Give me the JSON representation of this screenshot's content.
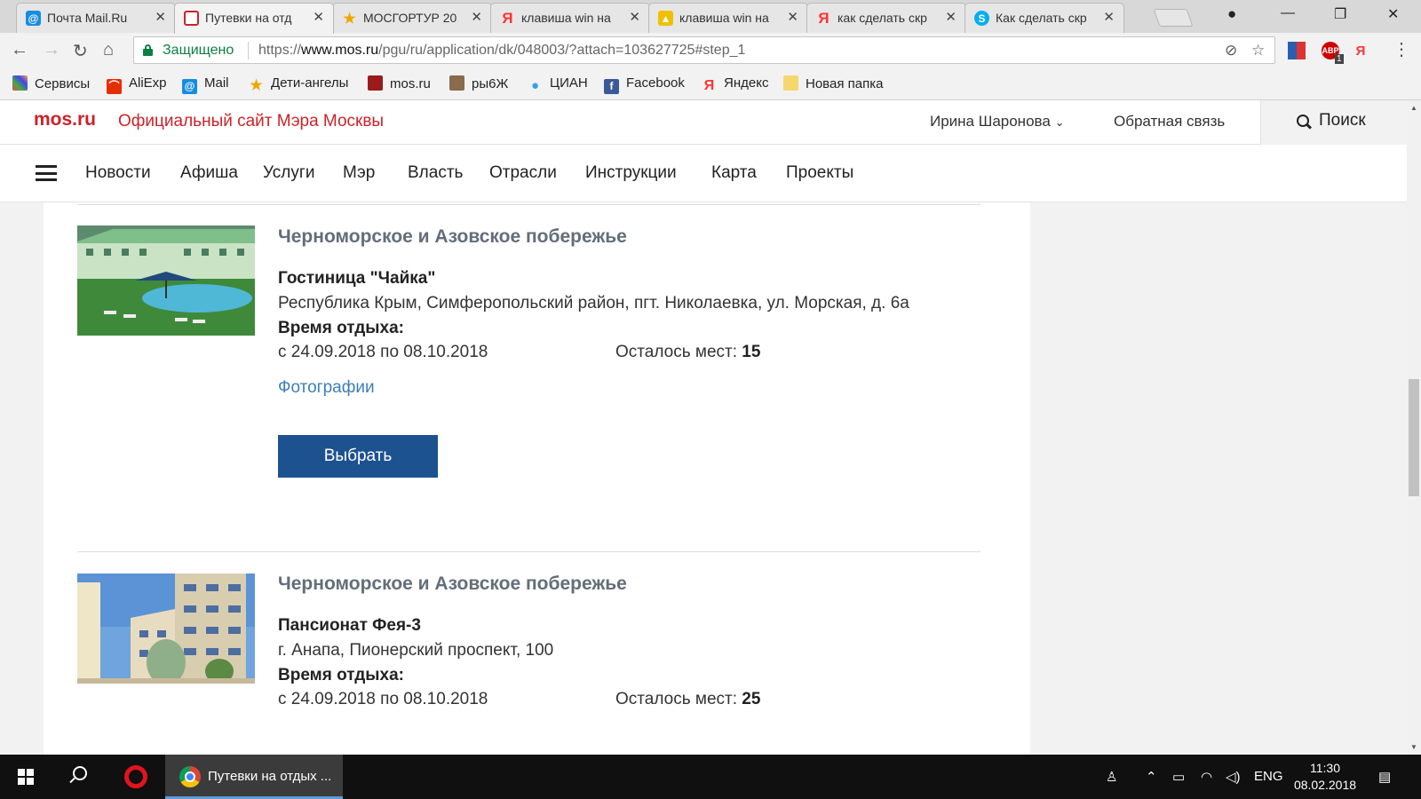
{
  "browser": {
    "tabs": [
      {
        "title": "Почта Mail.Ru",
        "icon": "mail-at-icon",
        "color": "#168de2"
      },
      {
        "title": "Путевки на отд",
        "icon": "mosru-page-icon",
        "color": "#cc2229"
      },
      {
        "title": "МОСГОРТУР 20",
        "icon": "star-icon",
        "color": "#f0a500"
      },
      {
        "title": "клавиша win на",
        "icon": "yandex-icon",
        "color": "#ff3333"
      },
      {
        "title": "клавиша win на",
        "icon": "yandex-images-icon",
        "color": "#f0c000"
      },
      {
        "title": "как сделать скр",
        "icon": "yandex-icon",
        "color": "#ff3333"
      },
      {
        "title": "Как сделать скр",
        "icon": "skype-icon",
        "color": "#00aff0"
      }
    ],
    "active_tab": 1,
    "secure_label": "Защищено",
    "url_scheme": "https://",
    "url_host": "www.mos.ru",
    "url_path": "/pgu/ru/application/dk/048003/?attach=103627725#step_1",
    "extensions": {
      "abp_label": "ABP",
      "abp_count": "1",
      "yandex_label": "Я"
    },
    "bookmarks": [
      {
        "label": "Сервисы",
        "icon": "apps-grid-icon",
        "color": "#e44"
      },
      {
        "label": "AliExp",
        "icon": "aliexpress-icon",
        "color": "#e62e04"
      },
      {
        "label": "Mail",
        "icon": "mail-at-icon",
        "color": "#168de2"
      },
      {
        "label": "Дети-ангелы",
        "icon": "star-icon",
        "color": "#f0a500"
      },
      {
        "label": "mos.ru",
        "icon": "mos-emblem-icon",
        "color": "#9b1b1b"
      },
      {
        "label": "ры6Ж",
        "icon": "photo-icon",
        "color": "#8a6b4c"
      },
      {
        "label": "ЦИАН",
        "icon": "map-pin-icon",
        "color": "#2fa3e6"
      },
      {
        "label": "Facebook",
        "icon": "facebook-icon",
        "color": "#3b5998"
      },
      {
        "label": "Яндекс",
        "icon": "yandex-icon",
        "color": "#ff3333"
      },
      {
        "label": "Новая папка",
        "icon": "folder-icon",
        "color": "#f5d76e"
      }
    ]
  },
  "site": {
    "logo": "mos.ru",
    "tagline": "Официальный сайт Мэра Москвы",
    "user_name": "Ирина Шаронова",
    "feedback": "Обратная связь",
    "search": "Поиск",
    "nav": [
      "Новости",
      "Афиша",
      "Услуги",
      "Мэр",
      "Власть",
      "Отрасли",
      "Инструкции",
      "Карта",
      "Проекты"
    ],
    "accent_color": "#cc2229",
    "button_color": "#1d5290"
  },
  "listings": [
    {
      "region": "Черноморское и Азовское побережье",
      "name": "Гостиница \"Чайка\"",
      "address": "Республика Крым, Симферопольский район, пгт. Николаевка, ул. Морская, д. 6а",
      "time_label": "Время отдыха:",
      "dates": "с 24.09.2018 по 08.10.2018",
      "places_label": "Осталось мест:",
      "places": "15",
      "photos_link": "Фотографии",
      "choose_button": "Выбрать"
    },
    {
      "region": "Черноморское и Азовское побережье",
      "name": "Пансионат Фея-3",
      "address": "г. Анапа, Пионерский проспект, 100",
      "time_label": "Время отдыха:",
      "dates": "с 24.09.2018 по 08.10.2018",
      "places_label": "Осталось мест:",
      "places": "25"
    }
  ],
  "taskbar": {
    "chrome_window": "Путевки на отдых ...",
    "language": "ENG",
    "time": "11:30",
    "date": "08.02.2018"
  }
}
